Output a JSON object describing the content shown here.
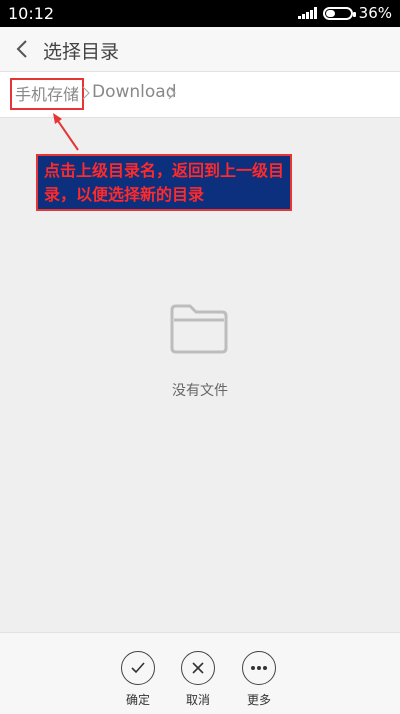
{
  "status_bar": {
    "time": "10:12",
    "battery": "36%",
    "battery_level": 0.36
  },
  "header": {
    "title": "选择目录"
  },
  "breadcrumb": {
    "root": "手机存储",
    "current": "Download"
  },
  "annotation": {
    "text": "点击上级目录名，返回到上一级目录，以便选择新的目录",
    "border_color": "#e53535",
    "background": "#0c2f7e",
    "text_color": "#ff2a2a"
  },
  "empty_state": {
    "text": "没有文件"
  },
  "actions": [
    {
      "label": "确定",
      "icon": "check-icon"
    },
    {
      "label": "取消",
      "icon": "close-icon"
    },
    {
      "label": "更多",
      "icon": "more-icon"
    }
  ]
}
